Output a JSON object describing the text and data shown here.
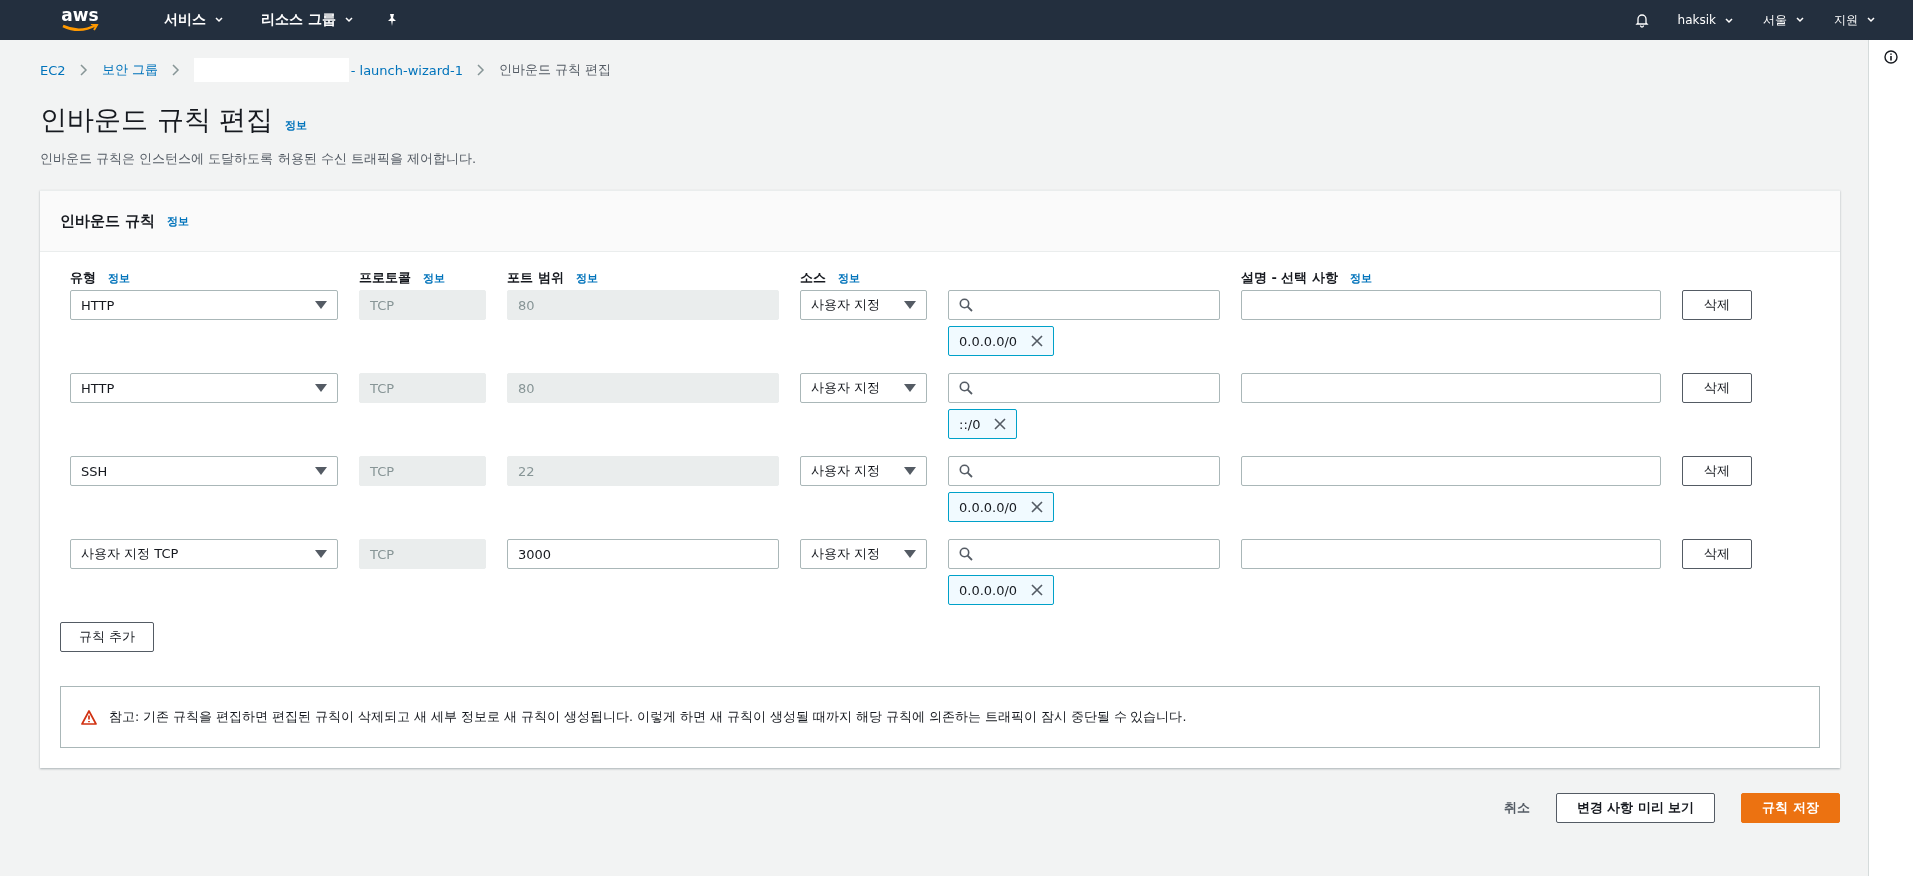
{
  "topbar": {
    "logo": "aws",
    "nav": [
      {
        "label": "서비스"
      },
      {
        "label": "리소스 그룹"
      }
    ],
    "user": "haksik",
    "region": "서울",
    "support": "지원"
  },
  "breadcrumb": {
    "items": [
      "EC2",
      "보안 그룹"
    ],
    "group_suffix": "- launch-wizard-1",
    "current": "인바운드 규칙 편집"
  },
  "page": {
    "title": "인바운드 규칙 편집",
    "info": "정보",
    "description": "인바운드 규칙은 인스턴스에 도달하도록 허용된 수신 트래픽을 제어합니다."
  },
  "panel": {
    "title": "인바운드 규칙",
    "info": "정보",
    "columns": [
      {
        "label": "유형",
        "info": "정보"
      },
      {
        "label": "프로토콜",
        "info": "정보"
      },
      {
        "label": "포트 범위",
        "info": "정보"
      },
      {
        "label": "소스",
        "info": "정보"
      },
      {
        "label": "설명 - 선택 사항",
        "info": "정보"
      }
    ],
    "rows": [
      {
        "type": "HTTP",
        "protocol": "TCP",
        "port": "80",
        "port_disabled": true,
        "source": "사용자 지정",
        "cidr": "0.0.0.0/0",
        "delete": "삭제"
      },
      {
        "type": "HTTP",
        "protocol": "TCP",
        "port": "80",
        "port_disabled": true,
        "source": "사용자 지정",
        "cidr": "::/0",
        "delete": "삭제"
      },
      {
        "type": "SSH",
        "protocol": "TCP",
        "port": "22",
        "port_disabled": true,
        "source": "사용자 지정",
        "cidr": "0.0.0.0/0",
        "delete": "삭제"
      },
      {
        "type": "사용자 지정 TCP",
        "protocol": "TCP",
        "port": "3000",
        "port_disabled": false,
        "source": "사용자 지정",
        "cidr": "0.0.0.0/0",
        "delete": "삭제"
      }
    ],
    "add_rule": "규칙 추가",
    "warning": "참고: 기존 규칙을 편집하면 편집된 규칙이 삭제되고 새 세부 정보로 새 규칙이 생성됩니다. 이렇게 하면 새 규칙이 생성될 때까지 해당 규칙에 의존하는 트래픽이 잠시 중단될 수 있습니다."
  },
  "footer": {
    "cancel": "취소",
    "preview": "변경 사항 미리 보기",
    "save": "규칙 저장"
  }
}
